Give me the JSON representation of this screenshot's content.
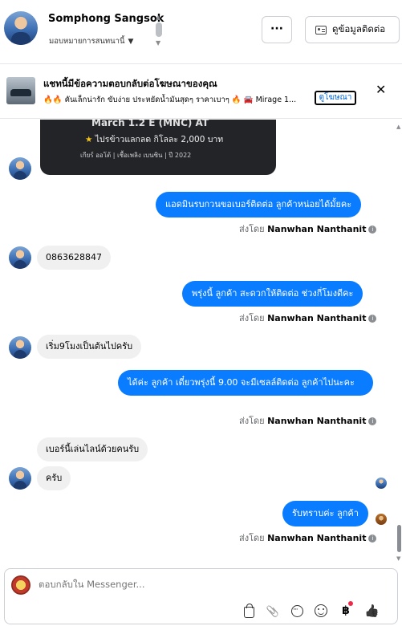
{
  "header": {
    "contact_name": "Somphong Sangsok",
    "assign_label": "มอบหมายการสนทนานี้",
    "more_label": "···",
    "contact_info_label": "ดูข้อมูลติดต่อ"
  },
  "ad": {
    "title": "แชทนี้มีข้อความตอบกลับต่อโฆษณาของคุณ",
    "subtitle": "🔥🔥 คันเล็กน่ารัก ขับง่าย ประหยัดน้ำมันสุดๆ ราคาเบาๆ 🔥 🚘 Mirage 1...",
    "link_label": "ดูโฆษณา",
    "card_line1": "March 1.2 E (MNC) AT",
    "card_line2": "ไปรข้าวแลกลด กิโลละ 2,000 บาท",
    "card_line3": "เกียร์ ออโต้   |   เชื้อเพลิง เบนซิน   |   ปี 2022"
  },
  "messages": [
    {
      "dir": "out",
      "text": "แอดมินรบกวนขอเบอร์ติดต่อ ลูกค้าหน่อยได้มั้ยคะ",
      "sent_prefix": "ส่งโดย",
      "sender": "Nanwhan Nanthanit"
    },
    {
      "dir": "in",
      "text": "0863628847"
    },
    {
      "dir": "out",
      "text": "พรุ่งนี้ ลูกค้า สะดวกให้ติดต่อ ช่วงกี่โมงดีคะ",
      "sent_prefix": "ส่งโดย",
      "sender": "Nanwhan Nanthanit"
    },
    {
      "dir": "in",
      "text": "เริ่ม9โมงเป็นต้นไปครับ"
    },
    {
      "dir": "out",
      "text": "ได้ค่ะ  ลูกค้า เดี๋ยวพรุ่งนี้ 9.00 จะมีเซลล์ติดต่อ ลูกค้าไปนะคะ",
      "sent_prefix": "ส่งโดย",
      "sender": "Nanwhan Nanthanit"
    },
    {
      "dir": "in",
      "text": "เบอร์นี้เล่นไลน์ด้วยคนรับ"
    },
    {
      "dir": "in",
      "text": "ครับ"
    },
    {
      "dir": "out",
      "text": "รับทราบค่ะ  ลูกค้า",
      "sent_prefix": "ส่งโดย",
      "sender": "Nanwhan Nanthanit"
    }
  ],
  "composer": {
    "placeholder": "ตอบกลับใน Messenger..."
  },
  "icons": {
    "more": "more-icon",
    "contact": "contact-card-icon",
    "close": "close-icon",
    "bag": "shopping-bag-icon",
    "attach": "paperclip-icon",
    "saved_reply": "chat-bubble-icon",
    "emoji": "smiley-icon",
    "payment": "baht-icon",
    "like": "thumbs-up-icon"
  },
  "colors": {
    "outgoing_bubble": "#0a7cff",
    "incoming_bubble": "#f0f0f0",
    "notification_dot": "#f02849"
  }
}
